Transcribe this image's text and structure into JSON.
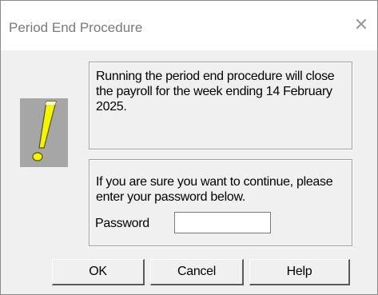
{
  "window": {
    "title": "Period End Procedure",
    "close_glyph": "✕"
  },
  "icon": {
    "name": "exclamation-icon",
    "background_color": "#a6a6a6",
    "glyph_color": "#f5f500"
  },
  "message": {
    "info": "Running the period end procedure will close the payroll  for the week ending 14 February 2025.",
    "prompt": "If you are sure you want to continue, please enter your password below."
  },
  "password": {
    "label": "Password",
    "value": ""
  },
  "buttons": {
    "ok": "OK",
    "cancel": "Cancel",
    "help": "Help"
  }
}
